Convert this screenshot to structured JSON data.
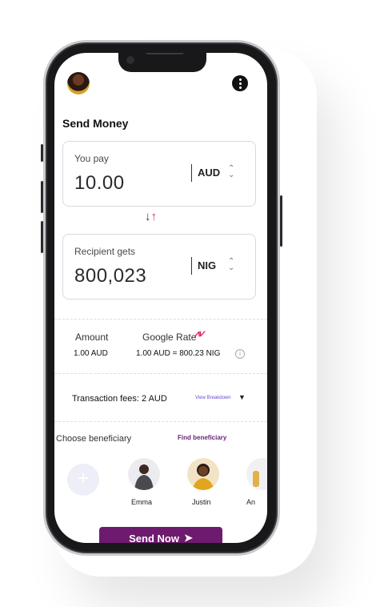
{
  "header": {
    "title": "Send Money"
  },
  "you_pay": {
    "label": "You pay",
    "amount": "10.00",
    "currency": "AUD"
  },
  "recipient": {
    "label": "Recipient gets",
    "amount": "800,023",
    "currency": "NIG"
  },
  "rate": {
    "amount_label": "Amount",
    "amount_value": "1.00 AUD",
    "google_rate_label": "Google Rate",
    "google_rate_value": "1.00 AUD = 800.23 NIG"
  },
  "fees": {
    "text": "Transaction fees: 2 AUD",
    "breakdown_link": "View Breakdown"
  },
  "beneficiaries": {
    "label": "Choose beneficiary",
    "find_link": "Find beneficiary",
    "items": [
      {
        "name": "Emma"
      },
      {
        "name": "Justin"
      },
      {
        "name": "An"
      }
    ]
  },
  "send_button": {
    "label": "Send Now"
  },
  "colors": {
    "accent": "#6e1a6e",
    "swap_up": "#e0245e",
    "link": "#6b4bd6"
  }
}
